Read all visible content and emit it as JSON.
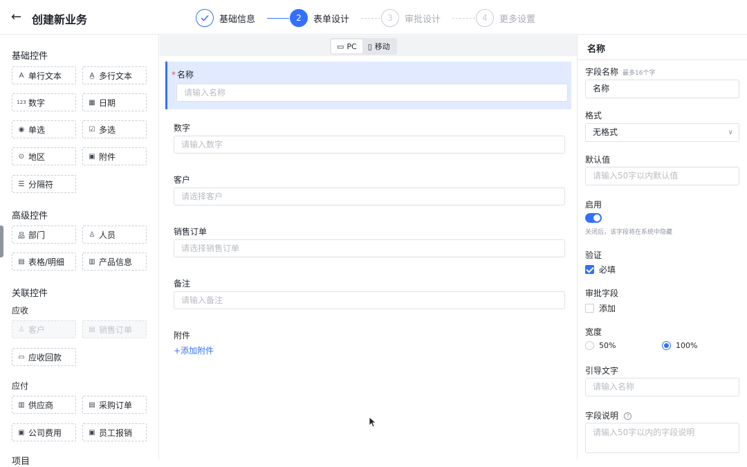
{
  "header": {
    "back_icon": "arrow-left-icon",
    "title": "创建新业务",
    "steps": [
      {
        "num": "",
        "label": "基础信息",
        "state": "done"
      },
      {
        "num": "2",
        "label": "表单设计",
        "state": "active"
      },
      {
        "num": "3",
        "label": "审批设计",
        "state": "pending"
      },
      {
        "num": "4",
        "label": "更多设置",
        "state": "pending"
      }
    ],
    "accent": "#3370ff"
  },
  "left": {
    "basic_title": "基础控件",
    "basic": [
      "单行文本",
      "多行文本",
      "数字",
      "日期",
      "单选",
      "多选",
      "地区",
      "附件",
      "分隔符"
    ],
    "advanced_title": "高级控件",
    "advanced": [
      "部门",
      "人员",
      "表格/明细",
      "产品信息"
    ],
    "related_title": "关联控件",
    "receivable_title": "应收",
    "receivable": [
      "客户",
      "销售订单",
      "应收回款"
    ],
    "payable_title": "应付",
    "payable": [
      "供应商",
      "采购订单",
      "公司费用",
      "员工报销"
    ],
    "more_title": "项目"
  },
  "center": {
    "view_pc": "PC",
    "view_mobile": "移动",
    "fields": [
      {
        "label": "名称",
        "placeholder": "请输入名称",
        "required": true
      },
      {
        "label": "数字",
        "placeholder": "请输入数字"
      },
      {
        "label": "客户",
        "placeholder": "请选择客户"
      },
      {
        "label": "销售订单",
        "placeholder": "请选择销售订单"
      },
      {
        "label": "备注",
        "placeholder": "请输入备注"
      },
      {
        "label": "附件",
        "link": "+添加附件"
      }
    ]
  },
  "right": {
    "title": "名称",
    "field_name_label": "字段名称",
    "field_name_hint": "最多16个字",
    "field_name_value": "名称",
    "format_label": "格式",
    "format_value": "无格式",
    "default_label": "默认值",
    "default_placeholder": "请输入50字以内默认值",
    "enable_label": "启用",
    "enable_on": true,
    "enable_hint": "关闭后，该字段将在系统中隐藏",
    "validate_label": "验证",
    "required_label": "必填",
    "required_checked": true,
    "approval_label": "审批字段",
    "approval_add": "添加",
    "approval_checked": false,
    "width_label": "宽度",
    "width_50": "50%",
    "width_100": "100%",
    "width_selected": "100%",
    "guide_label": "引导文字",
    "guide_placeholder": "请输入名称",
    "desc_label": "字段说明",
    "desc_placeholder": "请输入50字以内的字段说明"
  }
}
